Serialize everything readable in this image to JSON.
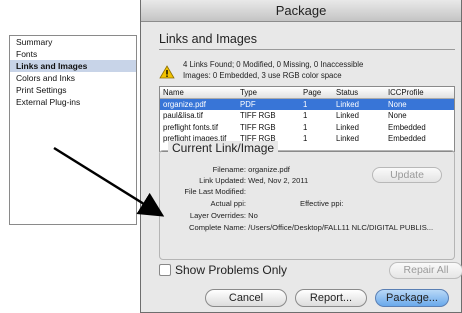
{
  "window": {
    "title": "Package"
  },
  "sidebar": {
    "items": [
      {
        "label": "Summary",
        "active": false
      },
      {
        "label": "Fonts",
        "active": false
      },
      {
        "label": "Links and Images",
        "active": true
      },
      {
        "label": "Colors and Inks",
        "active": false
      },
      {
        "label": "Print Settings",
        "active": false
      },
      {
        "label": "External Plug-ins",
        "active": false
      }
    ]
  },
  "main": {
    "title": "Links and Images",
    "info_line1": "4 Links Found; 0 Modified, 0 Missing, 0 Inaccessible",
    "info_line2": "Images: 0 Embedded, 3 use RGB color space",
    "warning_icon": "warning-icon",
    "table": {
      "headers": [
        "Name",
        "Type",
        "Page",
        "Status",
        "ICCProfile"
      ],
      "rows": [
        {
          "name": "organize.pdf",
          "type": "PDF",
          "page": "1",
          "status": "Linked",
          "icc": "None",
          "selected": true
        },
        {
          "name": "paul&lisa.tif",
          "type": "TIFF RGB",
          "page": "1",
          "status": "Linked",
          "icc": "None",
          "selected": false
        },
        {
          "name": "preflight fonts.tif",
          "type": "TIFF RGB",
          "page": "1",
          "status": "Linked",
          "icc": "Embedded",
          "selected": false
        },
        {
          "name": "preflight images.tif",
          "type": "TIFF RGB",
          "page": "1",
          "status": "Linked",
          "icc": "Embedded",
          "selected": false
        }
      ]
    }
  },
  "current_link": {
    "legend": "Current Link/Image",
    "filename_label": "Filename:",
    "filename_value": "organize.pdf",
    "link_updated_label": "Link Updated:",
    "link_updated_value": "Wed, Nov 2, 2011",
    "last_modified_label": "File Last Modified:",
    "actual_ppi_label": "Actual ppi:",
    "effective_ppi_label": "Effective ppi:",
    "layer_overrides_label": "Layer Overrides:",
    "layer_overrides_value": "No",
    "complete_name_label": "Complete Name:",
    "complete_name_value": "/Users/Office/Desktop/FALL11 NLC/DIGITAL PUBLIS...",
    "update_label": "Update"
  },
  "footer": {
    "show_problems_label": "Show Problems Only",
    "repair_all_label": "Repair All",
    "cancel_label": "Cancel",
    "report_label": "Report...",
    "package_label": "Package..."
  },
  "colors": {
    "selection": "#3875d7",
    "default_button": "#6aa9eb",
    "warning_yellow": "#f2c200"
  }
}
